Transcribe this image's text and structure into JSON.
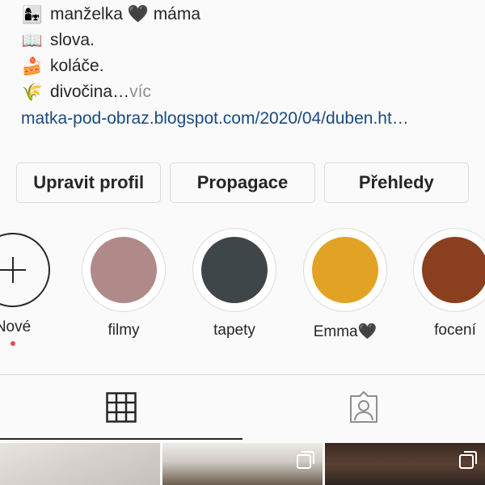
{
  "bio": {
    "lines": [
      {
        "emoji": "👩‍👧",
        "text": "manželka 🖤 máma"
      },
      {
        "emoji": "📖",
        "text": "slova."
      },
      {
        "emoji": "🍰",
        "text": "koláče."
      },
      {
        "emoji": "🌾",
        "text": "divočina"
      }
    ],
    "ellipsis": "…",
    "more_label": " víc",
    "link": "matka-pod-obraz.blogspot.com/2020/04/duben.ht…"
  },
  "buttons": {
    "edit_profile": "Upravit profil",
    "promotion": "Propagace",
    "insights": "Přehledy"
  },
  "highlights": [
    {
      "label": "Nové",
      "type": "new"
    },
    {
      "label": "filmy",
      "color": "#b08a88"
    },
    {
      "label": "tapety",
      "color": "#3f464a"
    },
    {
      "label": "Emma🖤",
      "color": "#e2a325"
    },
    {
      "label": "focení",
      "color": "#8a3f1f"
    }
  ],
  "tabs": {
    "grid_icon": "grid-icon",
    "tagged_icon": "tagged-person-icon",
    "active": "grid"
  },
  "posts": [
    {
      "icon": ""
    },
    {
      "icon": "multiple-posts-icon"
    },
    {
      "icon": "multiple-posts-icon"
    }
  ]
}
